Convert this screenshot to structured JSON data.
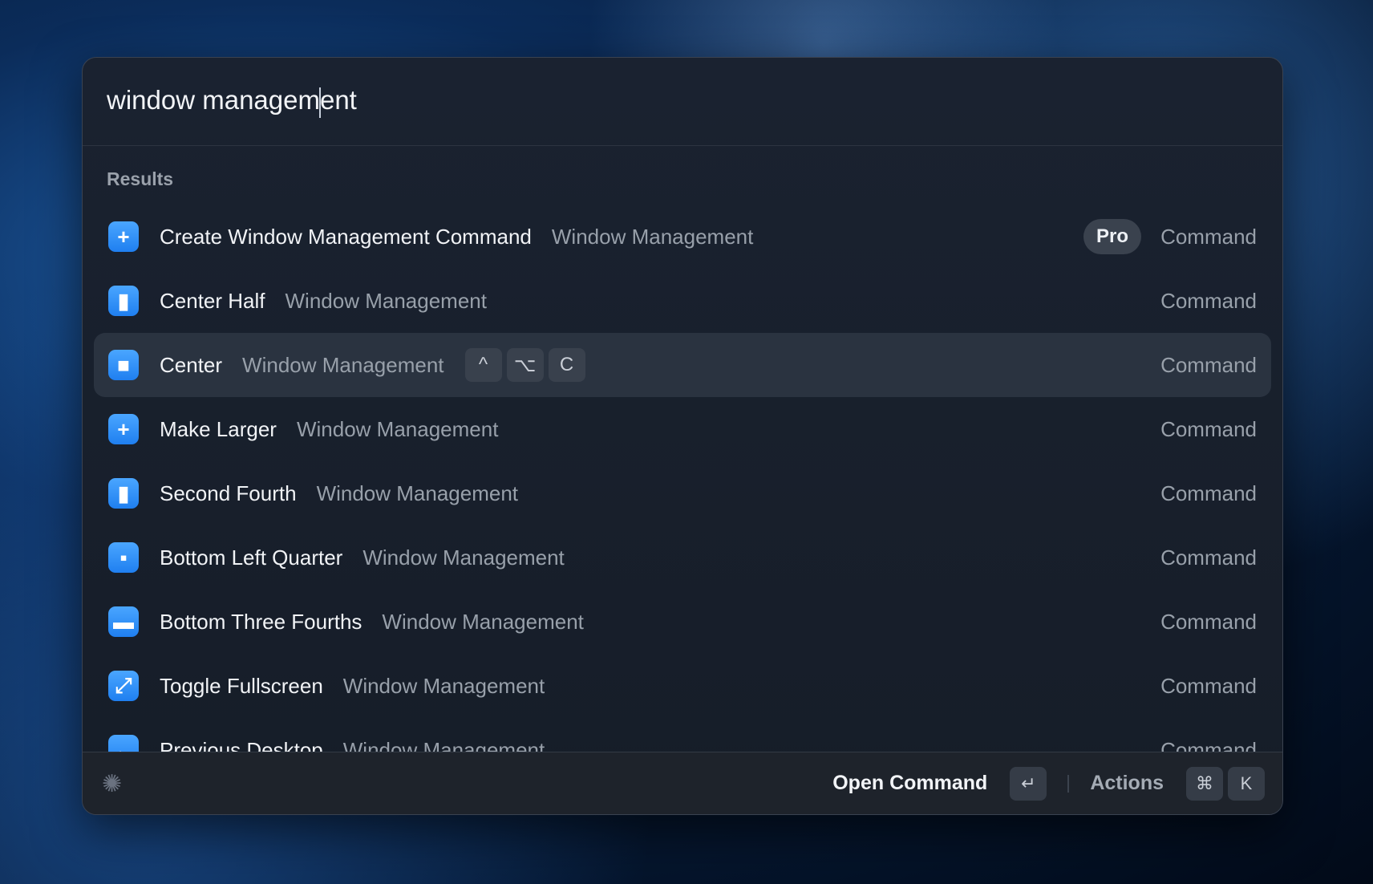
{
  "search": {
    "value_before": "window managem",
    "value_after": "ent"
  },
  "section_label": "Results",
  "results": [
    {
      "title": "Create Window Management Command",
      "subtitle": "Window Management",
      "badge": "Pro",
      "type": "Command",
      "icon": "dashed-plus-icon",
      "glyph": "+"
    },
    {
      "title": "Center Half",
      "subtitle": "Window Management",
      "type": "Command",
      "icon": "center-half-icon",
      "glyph": "▮"
    },
    {
      "title": "Center",
      "subtitle": "Window Management",
      "type": "Command",
      "icon": "center-icon",
      "glyph": "■",
      "shortcut": [
        "^",
        "⌥",
        "C"
      ]
    },
    {
      "title": "Make Larger",
      "subtitle": "Window Management",
      "type": "Command",
      "icon": "plus-icon",
      "glyph": "+"
    },
    {
      "title": "Second Fourth",
      "subtitle": "Window Management",
      "type": "Command",
      "icon": "second-fourth-icon",
      "glyph": "▮"
    },
    {
      "title": "Bottom Left Quarter",
      "subtitle": "Window Management",
      "type": "Command",
      "icon": "bottom-left-quarter-icon",
      "glyph": "▪"
    },
    {
      "title": "Bottom Three Fourths",
      "subtitle": "Window Management",
      "type": "Command",
      "icon": "bottom-three-fourths-icon",
      "glyph": "▬"
    },
    {
      "title": "Toggle Fullscreen",
      "subtitle": "Window Management",
      "type": "Command",
      "icon": "fullscreen-icon",
      "glyph": "⤢"
    },
    {
      "title": "Previous Desktop",
      "subtitle": "Window Management",
      "type": "Command",
      "icon": "previous-desktop-icon",
      "glyph": "←"
    }
  ],
  "footer": {
    "primary_action": "Open Command",
    "primary_key": "↵",
    "actions_label": "Actions",
    "actions_keys": [
      "⌘",
      "K"
    ]
  },
  "accent": "#2a8cff"
}
